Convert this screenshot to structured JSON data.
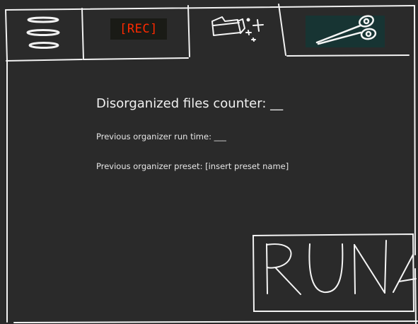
{
  "tabs": [
    {
      "id": "menu",
      "icon": "hamburger-menu-icon"
    },
    {
      "id": "record",
      "icon": "record-icon",
      "label": "[REC]"
    },
    {
      "id": "organize",
      "icon": "folder-sparkle-icon"
    },
    {
      "id": "cut",
      "icon": "scissors-icon"
    }
  ],
  "main": {
    "counter_label": "Disorganized files counter:",
    "counter_value": "__",
    "runtime_label": "Previous organizer run time:",
    "runtime_value": "___",
    "preset_label": "Previous organizer preset:",
    "preset_value": "[insert preset name]"
  },
  "run_button": {
    "label": "RUN"
  },
  "colors": {
    "background": "#2a2a2a",
    "stroke": "#f2f2f2",
    "rec_red": "#ff2a00",
    "rec_bg": "#1a1b16",
    "scissors_bg": "#173433"
  }
}
